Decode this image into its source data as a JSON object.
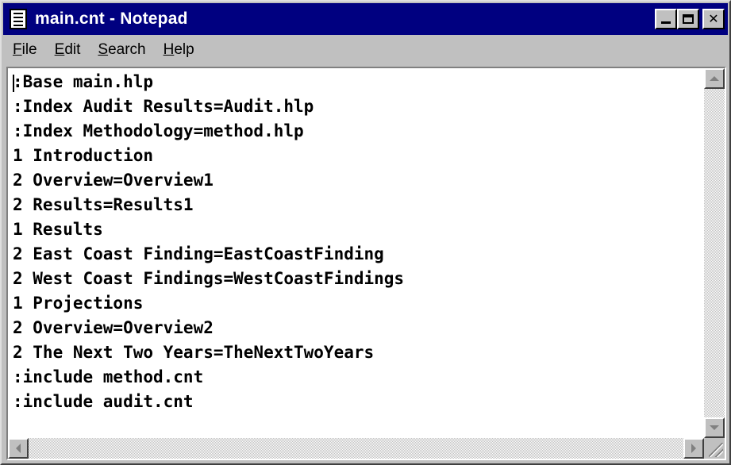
{
  "window": {
    "title": "main.cnt - Notepad",
    "app_icon": "notepad-icon",
    "controls": {
      "minimize": "minimize-icon",
      "maximize": "maximize-icon",
      "close": "close-icon",
      "close_glyph": "✕"
    }
  },
  "menu": {
    "items": [
      {
        "label": "File",
        "accel": "F",
        "rest": "ile"
      },
      {
        "label": "Edit",
        "accel": "E",
        "rest": "dit"
      },
      {
        "label": "Search",
        "accel": "S",
        "rest": "earch"
      },
      {
        "label": "Help",
        "accel": "H",
        "rest": "elp"
      }
    ]
  },
  "document": {
    "lines": [
      ":Base main.hlp",
      ":Index Audit Results=Audit.hlp",
      ":Index Methodology=method.hlp",
      "1 Introduction",
      "2 Overview=Overview1",
      "2 Results=Results1",
      "1 Results",
      "2 East Coast Finding=EastCoastFinding",
      "2 West Coast Findings=WestCoastFindings",
      "1 Projections",
      "2 Overview=Overview2",
      "2 The Next Two Years=TheNextTwoYears",
      ":include method.cnt",
      ":include audit.cnt"
    ]
  },
  "colors": {
    "titlebar": "#000080",
    "face": "#c0c0c0",
    "text_bg": "#ffffff"
  }
}
